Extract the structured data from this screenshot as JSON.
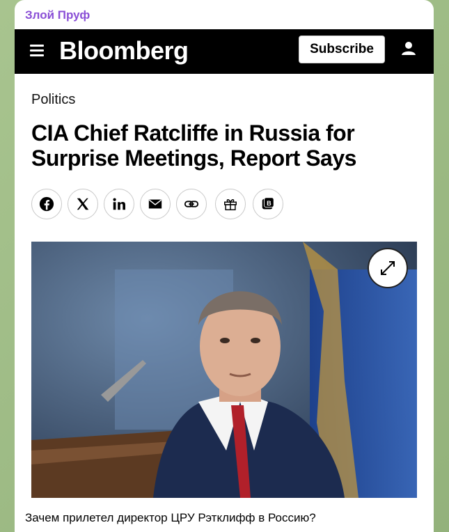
{
  "channel_name": "Злой Пруф",
  "site": {
    "logo": "Bloomberg",
    "subscribe_label": "Subscribe"
  },
  "article": {
    "category": "Politics",
    "headline": "CIA Chief Ratcliffe in Russia for Surprise Meetings, Report Says"
  },
  "share_icons": [
    "facebook-icon",
    "x-icon",
    "linkedin-icon",
    "email-icon",
    "link-icon",
    "gift-icon",
    "bloomberg-b-icon"
  ],
  "message_text": "Зачем прилетел директор ЦРУ Рэтклифф в Россию?",
  "colors": {
    "channel_name": "#8a4fd6",
    "header_bg": "#000000",
    "chat_bg": "#9fba86"
  }
}
